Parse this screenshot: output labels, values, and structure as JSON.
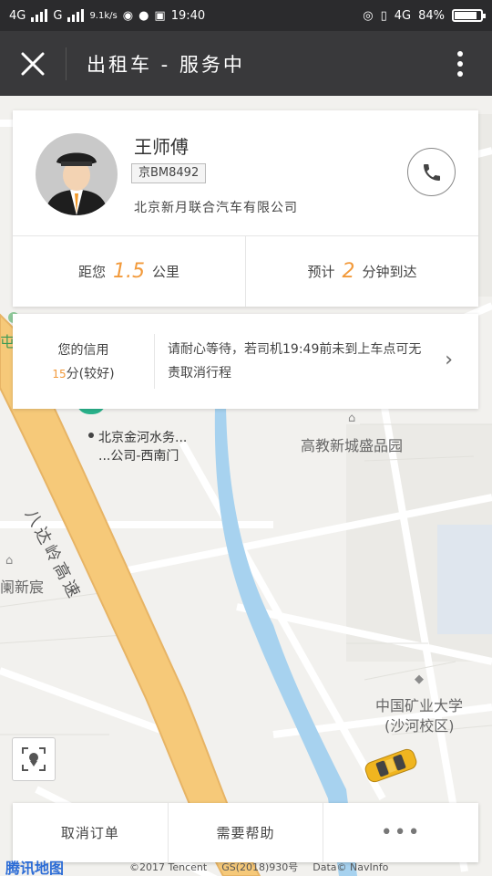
{
  "status_bar": {
    "network_1": "4G",
    "network_2": "G",
    "speed": "9.1k/s",
    "time": "19:40",
    "network_3": "4G",
    "battery": "84%"
  },
  "title_bar": {
    "title": "出租车 - 服务中"
  },
  "driver": {
    "name": "王师傅",
    "plate": "京BM8492",
    "company": "北京新月联合汽车有限公司",
    "distance_prefix": "距您",
    "distance_value": "1.5",
    "distance_unit": "公里",
    "eta_prefix": "预计",
    "eta_value": "2",
    "eta_unit": "分钟到达"
  },
  "credit": {
    "label": "您的信用",
    "score": "15",
    "score_text": "分(较好)",
    "message": "请耐心等待，若司机19:49前未到上车点可无责取消行程"
  },
  "map": {
    "pickup_label_line1": "北京金河水务...",
    "pickup_label_line2": "...公司-西南门",
    "highway_label": "八达岭高速",
    "poi_1": "高教新城盛品园",
    "poi_2": "中国矿业大学",
    "poi_3": "(沙河校区)",
    "poi_4": "阑新宸",
    "poi_5": "屯港"
  },
  "bottom_bar": {
    "cancel_label": "取消订单",
    "help_label": "需要帮助",
    "more_label": "•••"
  },
  "attribution": {
    "logo": "腾讯地图",
    "copyright": "©2017 Tencent",
    "license": "GS(2018)930号",
    "data": "Data© NavInfo"
  }
}
